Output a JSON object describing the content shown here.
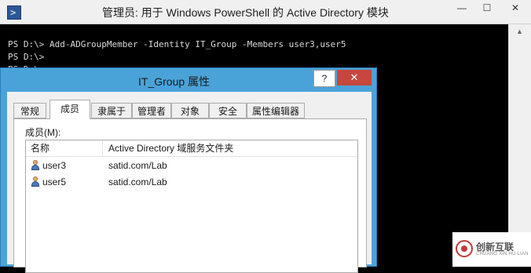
{
  "powershell": {
    "title": "管理员: 用于 Windows PowerShell 的 Active Directory 模块",
    "icon": "powershell-icon",
    "controls": {
      "minimize": "—",
      "maximize": "☐",
      "close": "✕"
    },
    "lines": [
      "PS D:\\> Add-ADGroupMember -Identity IT_Group -Members user3,user5",
      "PS D:\\>",
      "PS D:\\>"
    ]
  },
  "dialog": {
    "title": "IT_Group 属性",
    "help": "?",
    "close": "✕",
    "tabs": [
      "常规",
      "成员",
      "隶属于",
      "管理者",
      "对象",
      "安全",
      "属性编辑器"
    ],
    "active_tab": "成员",
    "members_label": "成员(M):",
    "columns": [
      "名称",
      "Active Directory 域服务文件夹"
    ],
    "rows": [
      {
        "name": "user3",
        "folder": "satid.com/Lab"
      },
      {
        "name": "user5",
        "folder": "satid.com/Lab"
      }
    ]
  },
  "watermark": {
    "text": "创新互联",
    "sub": "CHUANG XIN HU LIAN"
  },
  "colors": {
    "console_bg": "#000000",
    "dialog_frame": "#4aa3d8",
    "close_red": "#c7463d"
  }
}
